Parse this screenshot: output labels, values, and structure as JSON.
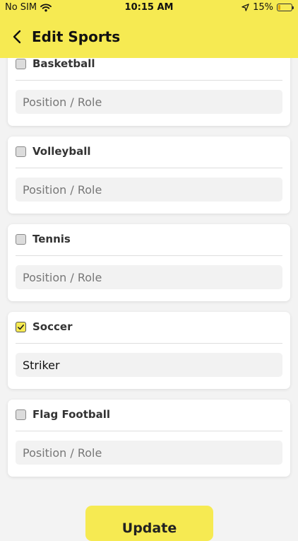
{
  "status_bar": {
    "carrier": "No SIM",
    "time": "10:15 AM",
    "battery": "15%",
    "battery_level": 0.15,
    "battery_color": "#e0a400"
  },
  "header": {
    "title": "Edit Sports",
    "back_icon": "chevron-left-icon",
    "background": "#f6ea52"
  },
  "sports": [
    {
      "name": "Basketball",
      "checked": false,
      "role_value": "",
      "role_placeholder": "Position / Role"
    },
    {
      "name": "Volleyball",
      "checked": false,
      "role_value": "",
      "role_placeholder": "Position / Role"
    },
    {
      "name": "Tennis",
      "checked": false,
      "role_value": "",
      "role_placeholder": "Position / Role"
    },
    {
      "name": "Soccer",
      "checked": true,
      "role_value": "Striker",
      "role_placeholder": "Position / Role"
    },
    {
      "name": "Flag Football",
      "checked": false,
      "role_value": "",
      "role_placeholder": "Position / Role"
    }
  ],
  "update_button": {
    "label": "Update"
  },
  "colors": {
    "accent": "#f6ea52",
    "page_background": "#f3f3f3",
    "input_background": "#f2f2f2"
  }
}
